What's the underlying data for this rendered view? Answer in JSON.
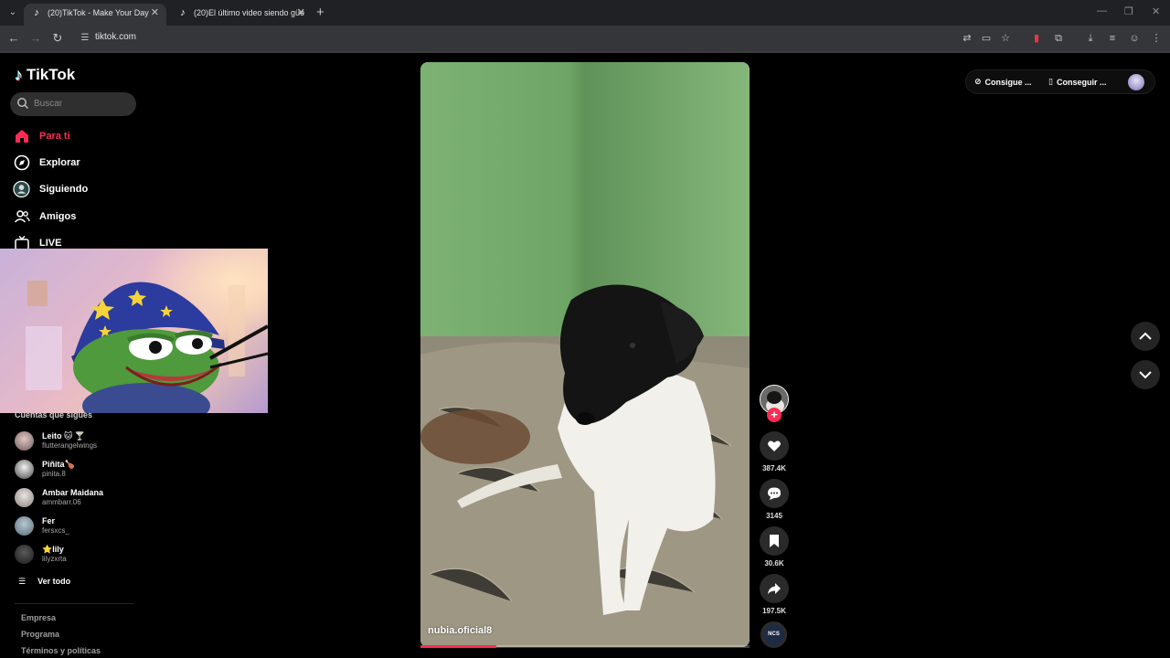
{
  "browser": {
    "tabs": [
      {
        "title": "(20)TikTok - Make Your Day",
        "active": true
      },
      {
        "title": "(20)El último video siendo güe",
        "active": false
      }
    ],
    "url": "tiktok.com"
  },
  "app": {
    "logo": "TikTok",
    "search_placeholder": "Buscar",
    "nav": [
      {
        "label": "Para ti",
        "icon": "home-icon",
        "active": true
      },
      {
        "label": "Explorar",
        "icon": "compass-icon"
      },
      {
        "label": "Siguiendo",
        "icon": "following-icon"
      },
      {
        "label": "Amigos",
        "icon": "friends-icon"
      },
      {
        "label": "LIVE",
        "icon": "live-icon"
      }
    ],
    "following_title": "Cuentas que sigues",
    "accounts": [
      {
        "name": "Leito 🐱 🍸",
        "handle": "flutterangelwings"
      },
      {
        "name": "Piñita🍗",
        "handle": "pinita.8"
      },
      {
        "name": "Ambar Maidana",
        "handle": "ammbarr.06"
      },
      {
        "name": "Fer",
        "handle": "fersxcs_"
      },
      {
        "name": "⭐lily",
        "handle": "lilyzxrta"
      }
    ],
    "see_all": "Ver todo",
    "footer": [
      "Empresa",
      "Programa",
      "Términos y políticas"
    ]
  },
  "video": {
    "username": "nubia.oficial8",
    "progress": 0.23,
    "likes": "387.4K",
    "comments": "3145",
    "saves": "30.6K",
    "shares": "197.5K",
    "music_label": "NCS"
  },
  "top_right": {
    "coins_label": "Consigue ...",
    "app_label": "Conseguir ..."
  },
  "colors": {
    "accent": "#fe2c55",
    "bg": "#000000"
  }
}
